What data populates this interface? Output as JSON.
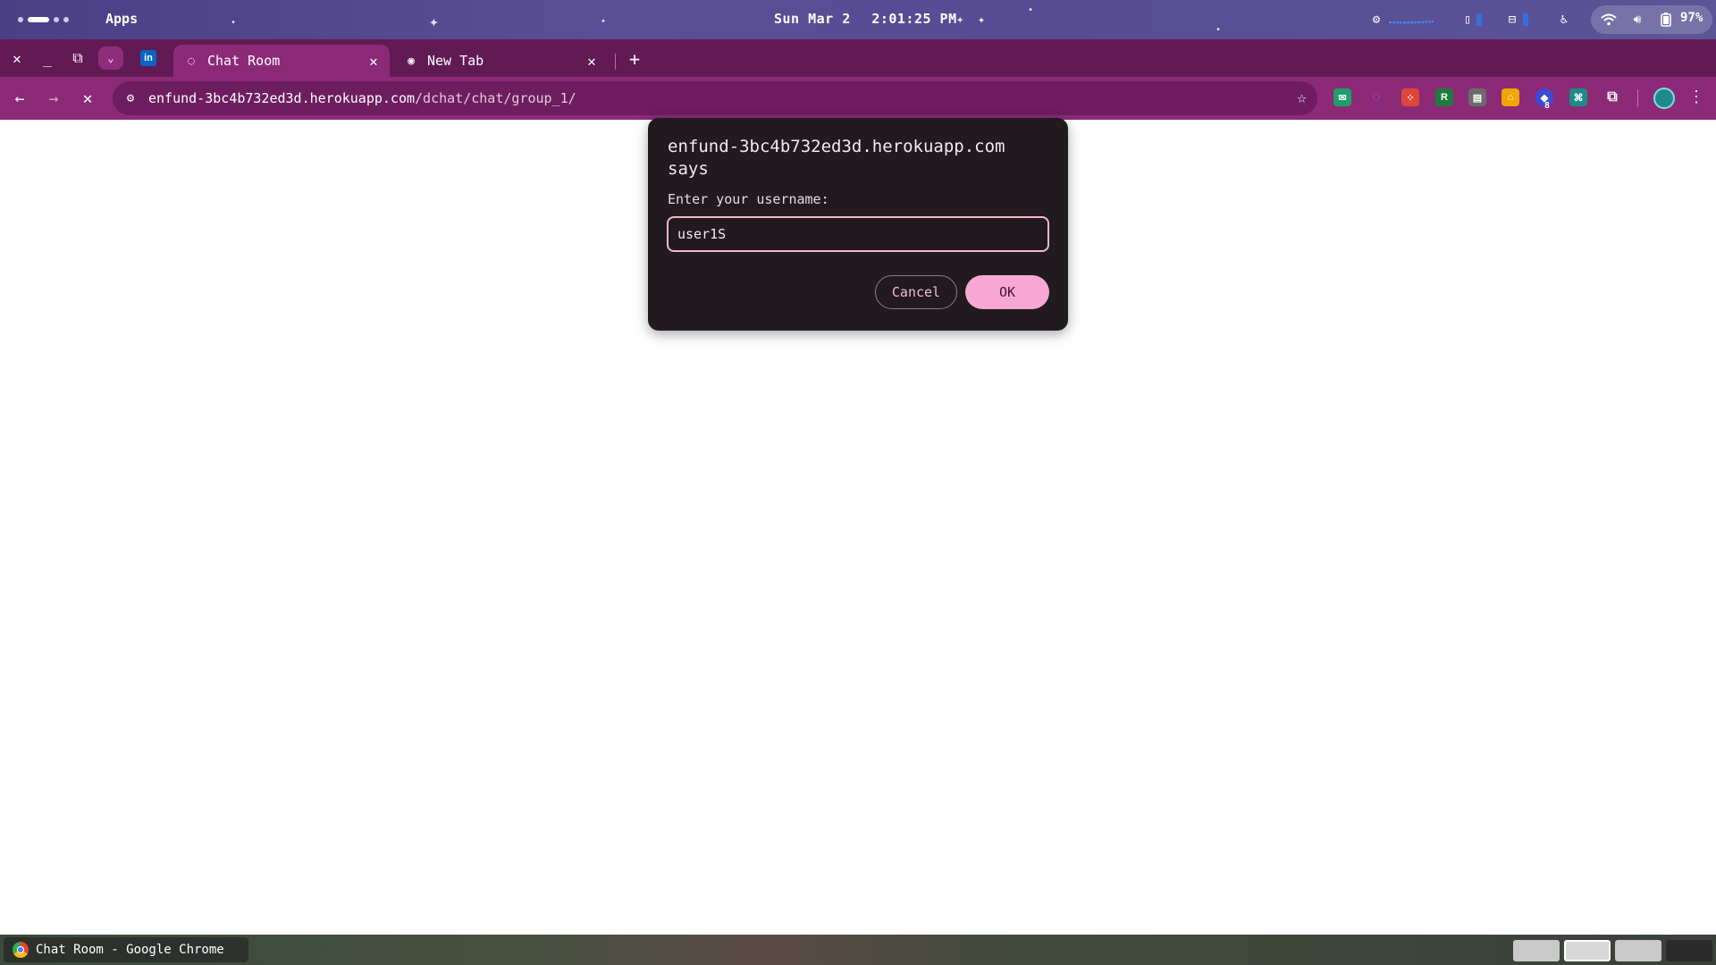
{
  "system_bar": {
    "apps_label": "Apps",
    "date": "Sun Mar 2",
    "time": "2:01:25 PM",
    "battery": "97%"
  },
  "tabs": [
    {
      "title": "Chat Room",
      "active": true
    },
    {
      "title": "New Tab",
      "active": false
    }
  ],
  "toolbar": {
    "url_host": "enfund-3bc4b732ed3d.herokuapp.com",
    "url_path": "/dchat/chat/group_1/",
    "extension_badge": "8"
  },
  "dialog": {
    "title": "enfund-3bc4b732ed3d.herokuapp.com says",
    "message": "Enter your username:",
    "input_value": "user1S",
    "cancel_label": "Cancel",
    "ok_label": "OK"
  },
  "shelf": {
    "window_title": "Chat Room - Google Chrome"
  },
  "colors": {
    "tab_strip": "#621a55",
    "toolbar": "#8c2a78",
    "dialog_bg": "#211a1e",
    "accent": "#f7a8d2"
  }
}
